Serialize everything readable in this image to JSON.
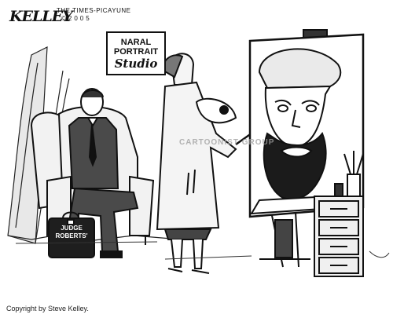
{
  "cartoon": {
    "signature": "KELLEY",
    "publication_line1": "THE TIMES-PICAYUNE",
    "publication_line2": "©2005",
    "sign_line1": "NARAL",
    "sign_line2": "PORTRAIT",
    "sign_line3": "Studio",
    "briefcase_line1": "JUDGE",
    "briefcase_line2": "ROBERTS'",
    "watermark": "CARTOONIST GROUP",
    "copyright": "Copyright by Steve Kelley."
  }
}
